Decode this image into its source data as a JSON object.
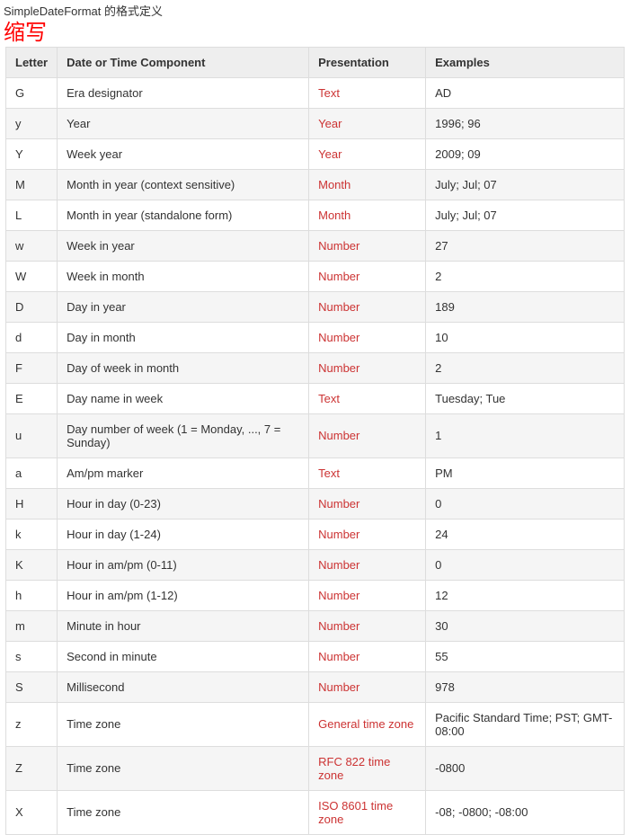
{
  "title": "SimpleDateFormat 的格式定义",
  "annotation": "缩写",
  "headers": [
    "Letter",
    "Date or Time Component",
    "Presentation",
    "Examples"
  ],
  "rows": [
    {
      "letter": "G",
      "component": "Era designator",
      "presentation": "Text",
      "examples": "AD"
    },
    {
      "letter": "y",
      "component": "Year",
      "presentation": "Year",
      "examples": "1996; 96"
    },
    {
      "letter": "Y",
      "component": "Week year",
      "presentation": "Year",
      "examples": "2009; 09"
    },
    {
      "letter": "M",
      "component": "Month in year (context sensitive)",
      "presentation": "Month",
      "examples": "July; Jul; 07"
    },
    {
      "letter": "L",
      "component": "Month in year (standalone form)",
      "presentation": "Month",
      "examples": "July; Jul; 07"
    },
    {
      "letter": "w",
      "component": "Week in year",
      "presentation": "Number",
      "examples": "27"
    },
    {
      "letter": "W",
      "component": "Week in month",
      "presentation": "Number",
      "examples": "2"
    },
    {
      "letter": "D",
      "component": "Day in year",
      "presentation": "Number",
      "examples": "189"
    },
    {
      "letter": "d",
      "component": "Day in month",
      "presentation": "Number",
      "examples": "10"
    },
    {
      "letter": "F",
      "component": "Day of week in month",
      "presentation": "Number",
      "examples": "2"
    },
    {
      "letter": "E",
      "component": "Day name in week",
      "presentation": "Text",
      "examples": "Tuesday; Tue"
    },
    {
      "letter": "u",
      "component": "Day number of week (1 = Monday, ..., 7 = Sunday)",
      "presentation": "Number",
      "examples": "1"
    },
    {
      "letter": "a",
      "component": "Am/pm marker",
      "presentation": "Text",
      "examples": "PM"
    },
    {
      "letter": "H",
      "component": "Hour in day (0-23)",
      "presentation": "Number",
      "examples": "0"
    },
    {
      "letter": "k",
      "component": "Hour in day (1-24)",
      "presentation": "Number",
      "examples": "24"
    },
    {
      "letter": "K",
      "component": "Hour in am/pm (0-11)",
      "presentation": "Number",
      "examples": "0"
    },
    {
      "letter": "h",
      "component": "Hour in am/pm (1-12)",
      "presentation": "Number",
      "examples": "12"
    },
    {
      "letter": "m",
      "component": "Minute in hour",
      "presentation": "Number",
      "examples": "30"
    },
    {
      "letter": "s",
      "component": "Second in minute",
      "presentation": "Number",
      "examples": "55"
    },
    {
      "letter": "S",
      "component": "Millisecond",
      "presentation": "Number",
      "examples": "978"
    },
    {
      "letter": "z",
      "component": "Time zone",
      "presentation": "General time zone",
      "examples": "Pacific Standard Time; PST; GMT-08:00"
    },
    {
      "letter": "Z",
      "component": "Time zone",
      "presentation": "RFC 822 time zone",
      "examples": "-0800"
    },
    {
      "letter": "X",
      "component": "Time zone",
      "presentation": "ISO 8601 time zone",
      "examples": "-08; -0800; -08:00"
    }
  ]
}
